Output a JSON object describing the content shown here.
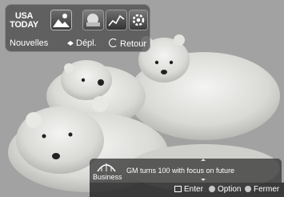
{
  "widget_bar": {
    "tiles": [
      {
        "id": "usatoday",
        "name": "usatoday-logo",
        "line1": "USA",
        "line2": "TODAY"
      },
      {
        "id": "photos",
        "name": "photo-widget-icon"
      },
      {
        "id": "weather",
        "name": "weather-widget-icon"
      },
      {
        "id": "stocks",
        "name": "stocks-widget-icon"
      },
      {
        "id": "settings",
        "name": "settings-widget-icon"
      }
    ],
    "selected_label": "Nouvelles",
    "move_label": "Dépl.",
    "back_label": "Retour"
  },
  "news": {
    "category": "Business",
    "headline": "GM turns 100 with focus on future"
  },
  "help_bar": {
    "enter": "Enter",
    "option": "Option",
    "close": "Fermer"
  },
  "colors": {
    "panel": "#464646",
    "text": "#ffffff",
    "button_dot": "#c8c8c8"
  }
}
